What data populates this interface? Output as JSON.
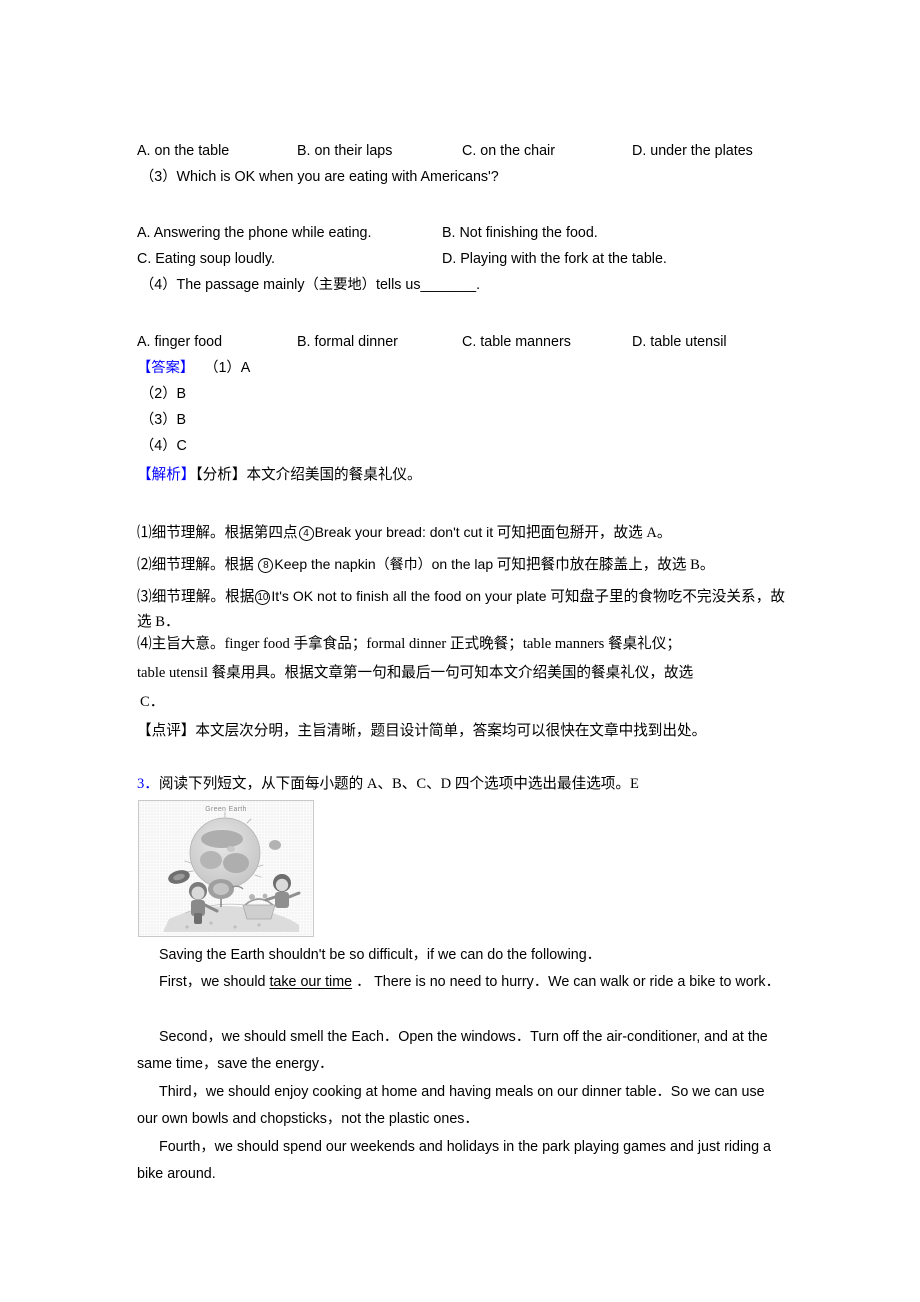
{
  "colors": {
    "marker_blue": "#0000ff",
    "text": "#000000"
  },
  "question_2_tail": {
    "q2_options": [
      "A. on the table",
      "B. on their laps",
      "C. on the chair",
      "D. under the plates"
    ],
    "q3_stem": "（3）Which is OK when you are eating with Americans'?",
    "q3_options": [
      "A. Answering the phone while eating.",
      "B. Not finishing the food.",
      "C. Eating soup loudly.",
      "D. Playing with the fork at the table."
    ],
    "q4_stem": "（4）The passage mainly（主要地）tells us_______.",
    "q4_options": [
      "A. finger food",
      "B. formal dinner",
      "C. table manners",
      "D. table utensil"
    ]
  },
  "answer_block": {
    "label": "【答案】",
    "first": "（1）A",
    "rest": [
      "（2）B",
      "（3）B",
      "（4）C"
    ]
  },
  "analysis_block": {
    "label": "【解析】",
    "sub_label": "【分析】",
    "summary": "本文介绍美国的餐桌礼仪。",
    "items": [
      {
        "num": "⑴",
        "before": "细节理解。根据第四点",
        "circle": "4",
        "english": "Break your bread: don't cut it",
        "after": " 可知把面包掰开，故选 A。"
      },
      {
        "num": "⑵",
        "before": "细节理解。根据 ",
        "circle": "8",
        "english": "Keep the napkin（餐巾）on the lap",
        "after": " 可知把餐巾放在膝盖上，故选 B。"
      },
      {
        "num": "⑶",
        "before": "细节理解。根据",
        "circle": "10",
        "english": "It's OK not to finish all the food on your plate",
        "after": " 可知盘子里的食物吃不完没关系，故选 B．"
      }
    ],
    "item4_line1": "⑷主旨大意。finger food 手拿食品；formal dinner 正式晚餐；table manners 餐桌礼仪；",
    "item4_line2": "table utensil 餐桌用具。根据文章第一句和最后一句可知本文介绍美国的餐桌礼仪，故选",
    "item4_line3": "C．"
  },
  "comment_block": {
    "label": "【点评】",
    "text": "本文层次分明，主旨清晰，题目设计简单，答案均可以很快在文章中找到出处。"
  },
  "question_3": {
    "number": "3．",
    "instruction": "阅读下列短文，从下面每小题的 A、B、C、D 四个选项中选出最佳选项。E",
    "figure": {
      "title": "Green Earth",
      "alt": "grayscale illustration of earth with children recycling"
    },
    "passage": [
      "Saving the Earth shouldn't be so difficult，if we can do the following．",
      "First，we should take our time ． There is no need to hurry．We can walk or ride a bike to work．",
      "Second，we should smell the Each．Open the windows．Turn off the air-conditioner, and at the same time，save the energy．",
      "Third，we should enjoy cooking at home and having meals on our dinner table．So we can use our own bowls and chopsticks，not the plastic ones．",
      "Fourth，we should spend our weekends and holidays in the park playing games and just riding a bike around."
    ],
    "underlined_phrase": "take our time"
  }
}
